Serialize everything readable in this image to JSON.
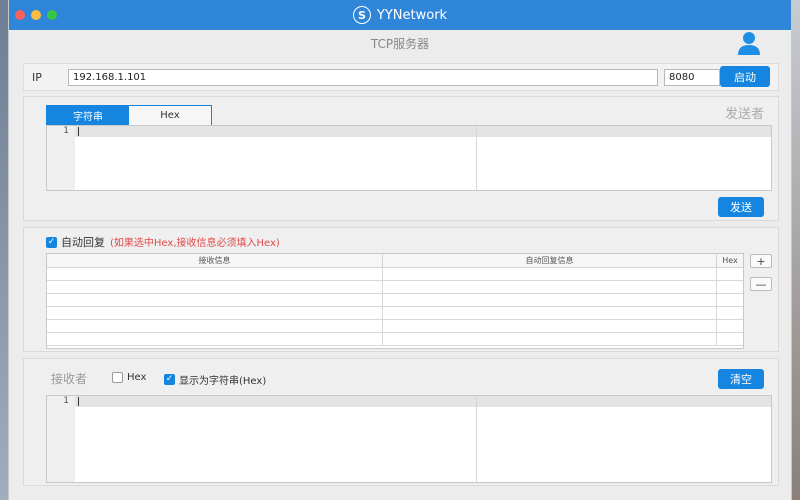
{
  "window": {
    "app_title": "YYNetwork",
    "logo_letter": "S",
    "subtitle": "TCP服务器"
  },
  "connection": {
    "ip_label": "IP",
    "ip_value": "192.168.1.101",
    "port_value": "8080",
    "start_label": "启动"
  },
  "send": {
    "tabs": [
      {
        "label": "字符串",
        "active": true
      },
      {
        "label": "Hex",
        "active": false
      }
    ],
    "sender_label": "发送者",
    "line_number": "1",
    "send_label": "发送"
  },
  "auto_reply": {
    "checkbox_label": "自动回复",
    "checked": true,
    "hint": "(如果选中Hex,接收信息必须填入Hex)",
    "columns": [
      "接收信息",
      "自动回复信息",
      "Hex"
    ],
    "row_count": 6,
    "add_label": "+",
    "remove_label": "—"
  },
  "receive": {
    "receiver_label": "接收者",
    "hex_option_label": "Hex",
    "hex_checked": false,
    "string_option_label": "显示为字符串(Hex)",
    "string_checked": true,
    "clear_label": "清空",
    "line_number": "1"
  },
  "colors": {
    "accent": "#1585e0",
    "titlebar": "#2f86d9",
    "hint_red": "#e14b4b"
  }
}
